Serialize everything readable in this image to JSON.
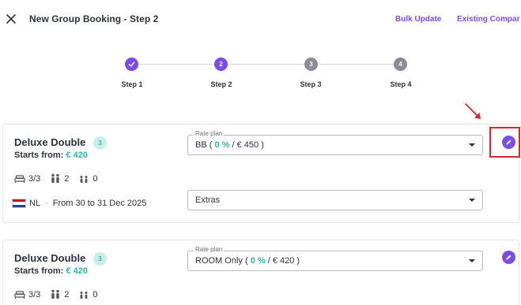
{
  "header": {
    "title": "New Group Booking - Step 2",
    "links": {
      "bulk_update": "Bulk Update",
      "existing_company": "Existing Compar"
    }
  },
  "stepper": {
    "steps": [
      {
        "label": "Step 1",
        "number": "1",
        "state": "done"
      },
      {
        "label": "Step 2",
        "number": "2",
        "state": "active"
      },
      {
        "label": "Step 3",
        "number": "3",
        "state": "todo"
      },
      {
        "label": "Step 4",
        "number": "4",
        "state": "todo"
      }
    ]
  },
  "colors": {
    "accent": "#7b4ce8",
    "teal": "#2eb8a6",
    "annotation_red": "#d6262b"
  },
  "rooms": [
    {
      "name": "Deluxe Double",
      "quantity": "3",
      "starts_label": "Starts from:",
      "starts_price": "€ 420",
      "rooms_count": "3/3",
      "adults": "2",
      "children": "0",
      "rate_plan_label": "Rate plan",
      "rate_plan_prefix": "BB (",
      "rate_plan_pct": "0 %",
      "rate_plan_suffix": "/ € 450 )",
      "market": "NL",
      "dates": "From 30 to 31 Dec 2025",
      "extras_label": "Extras"
    },
    {
      "name": "Deluxe Double",
      "quantity": "3",
      "starts_label": "Starts from:",
      "starts_price": "€ 420",
      "rooms_count": "3/3",
      "adults": "2",
      "children": "0",
      "rate_plan_label": "Rate plan",
      "rate_plan_prefix": "ROOM Only (",
      "rate_plan_pct": "0 %",
      "rate_plan_suffix": "/ € 420 )"
    }
  ]
}
